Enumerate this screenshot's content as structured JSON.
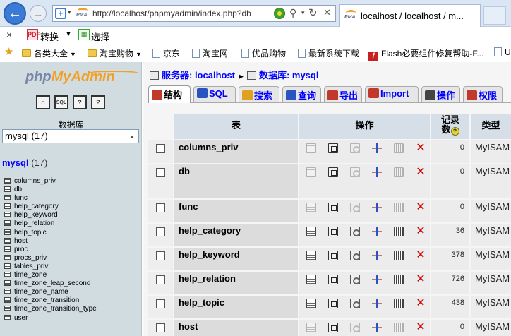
{
  "browser": {
    "url": "http://localhost/phpmyadmin/index.php?db",
    "tab_title": "localhost / localhost / m...",
    "favicon_text": "PMA",
    "icons": [
      "back-arrow-icon",
      "forward-arrow-icon",
      "shield-icon",
      "compat-view-icon",
      "search-icon",
      "refresh-icon",
      "close-icon"
    ]
  },
  "command_bar": {
    "close": "×",
    "convert_label": "转换",
    "select_label": "选择"
  },
  "favorites": [
    {
      "label": "各类大全",
      "icon": "folder-icon",
      "dropdown": true
    },
    {
      "label": "淘宝购物",
      "icon": "folder-icon",
      "dropdown": true
    },
    {
      "label": "京东",
      "icon": "page-icon"
    },
    {
      "label": "淘宝网",
      "icon": "page-icon"
    },
    {
      "label": "优品购物",
      "icon": "page-icon"
    },
    {
      "label": "最新系统下载",
      "icon": "page-icon"
    },
    {
      "label": "Flash必要组件修复帮助-F...",
      "icon": "flash-icon"
    },
    {
      "label": "U",
      "icon": "page-icon"
    }
  ],
  "left": {
    "logo_php": "php",
    "logo_my": "My",
    "logo_admin": "Admin",
    "quick_buttons": [
      {
        "name": "home-icon",
        "glyph": "⌂"
      },
      {
        "name": "sql-icon",
        "glyph": "SQL"
      },
      {
        "name": "docs-icon",
        "glyph": "?"
      },
      {
        "name": "help-icon",
        "glyph": "?"
      }
    ],
    "db_heading": "数据库",
    "db_select_value": "mysql (17)",
    "db_name": "mysql",
    "db_count": "(17)",
    "tables": [
      "columns_priv",
      "db",
      "func",
      "help_category",
      "help_keyword",
      "help_relation",
      "help_topic",
      "host",
      "proc",
      "procs_priv",
      "tables_priv",
      "time_zone",
      "time_zone_leap_second",
      "time_zone_name",
      "time_zone_transition",
      "time_zone_transition_type",
      "user"
    ]
  },
  "right": {
    "crumb_server_label": "服务器: localhost",
    "crumb_db_label": "数据库: mysql",
    "tabs": [
      {
        "label": "结构",
        "color": "#c0392b"
      },
      {
        "label": "SQL",
        "color": "#2a53c2"
      },
      {
        "label": "搜索",
        "color": "#e0a020"
      },
      {
        "label": "查询",
        "color": "#2a53c2"
      },
      {
        "label": "导出",
        "color": "#c0392b"
      },
      {
        "label": "Import",
        "color": "#c0392b"
      },
      {
        "label": "操作",
        "color": "#444444"
      },
      {
        "label": "权限",
        "color": "#c0392b"
      }
    ],
    "col_table": "表",
    "col_action": "操作",
    "col_records_1": "记录",
    "col_records_2": "数",
    "col_type": "类型",
    "rows": [
      {
        "name": "columns_priv",
        "records": "0",
        "type": "MyISAM",
        "has_data": false
      },
      {
        "name": "db",
        "records": "0",
        "type": "MyISAM",
        "has_data": false
      },
      {
        "name": "func",
        "records": "0",
        "type": "MyISAM",
        "has_data": false
      },
      {
        "name": "help_category",
        "records": "36",
        "type": "MyISAM",
        "has_data": true
      },
      {
        "name": "help_keyword",
        "records": "378",
        "type": "MyISAM",
        "has_data": true
      },
      {
        "name": "help_relation",
        "records": "726",
        "type": "MyISAM",
        "has_data": true
      },
      {
        "name": "help_topic",
        "records": "438",
        "type": "MyISAM",
        "has_data": true
      },
      {
        "name": "host",
        "records": "0",
        "type": "MyISAM",
        "has_data": false
      }
    ]
  }
}
